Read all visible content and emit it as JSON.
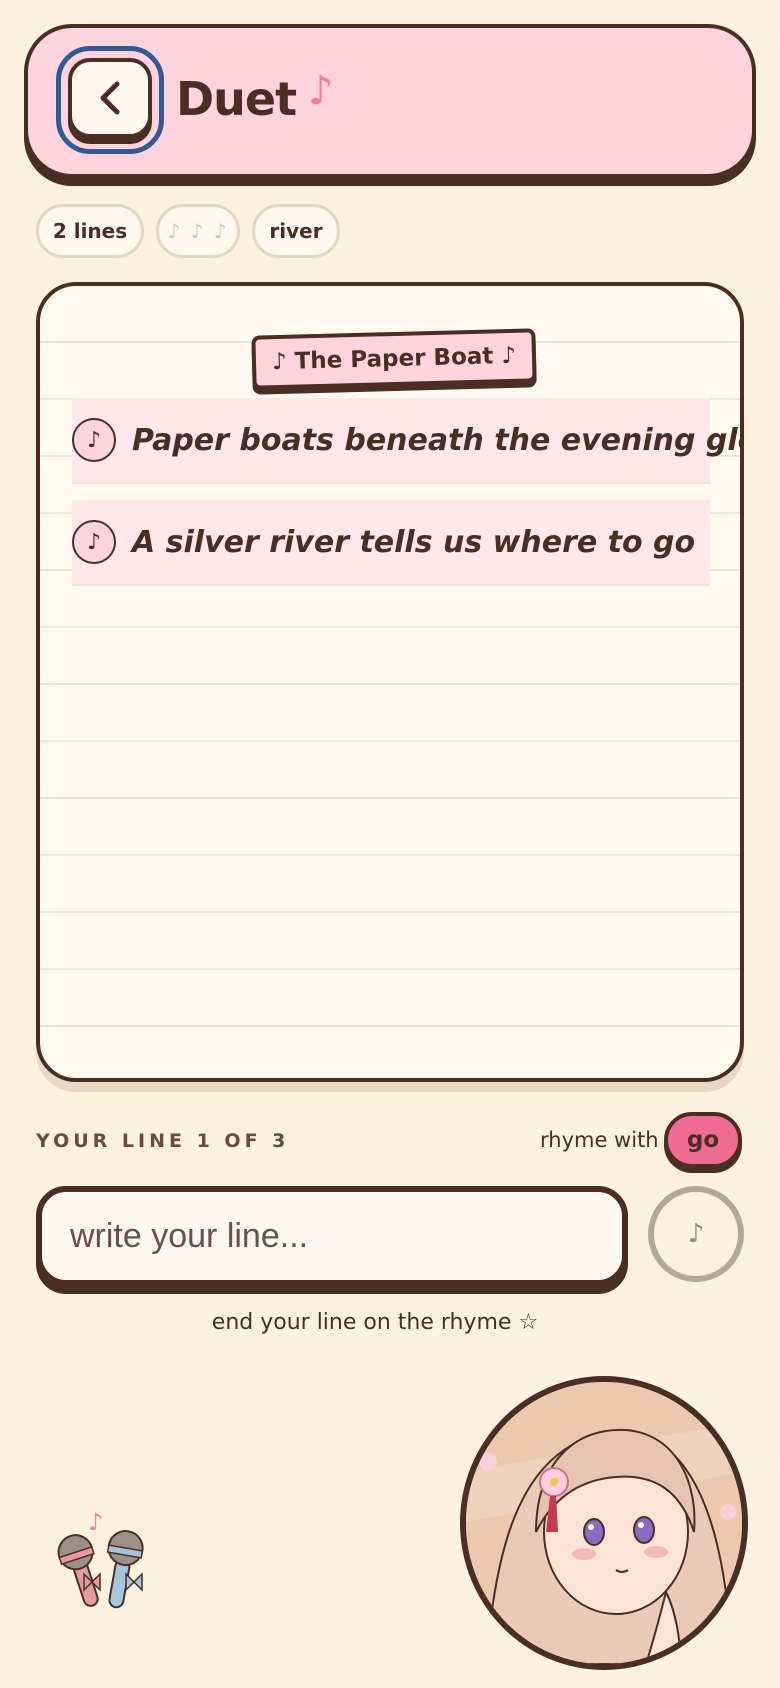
{
  "header": {
    "title": "Duet"
  },
  "chips": {
    "lines": "2 lines",
    "notes": "♪ ♪ ♪",
    "rhyme_word": "river"
  },
  "paper": {
    "title": "♪ The Paper Boat ♪",
    "lines": [
      "Paper boats beneath the evening glow",
      "A silver river tells us where to go"
    ]
  },
  "compose": {
    "progress": "YOUR LINE 1 OF 3",
    "rhyme_with": "rhyme with",
    "rhyme_target": "go",
    "placeholder": "write your line...",
    "hint": "end your line on the rhyme ☆"
  },
  "colors": {
    "pink": "#ffd4dc",
    "accent": "#f06b93",
    "ink": "#4a2e24",
    "bg": "#fdf1e0"
  }
}
